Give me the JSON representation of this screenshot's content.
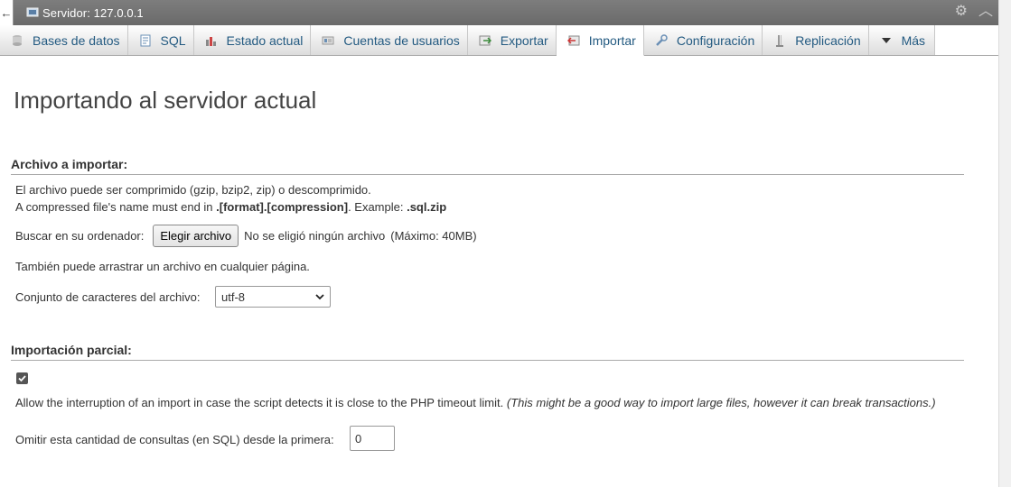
{
  "topbar": {
    "back_label": "←",
    "server_title": "Servidor: 127.0.0.1"
  },
  "tabs": [
    {
      "label": "Bases de datos",
      "icon": "database-icon"
    },
    {
      "label": "SQL",
      "icon": "sql-icon"
    },
    {
      "label": "Estado actual",
      "icon": "status-chart-icon"
    },
    {
      "label": "Cuentas de usuarios",
      "icon": "users-icon"
    },
    {
      "label": "Exportar",
      "icon": "export-icon"
    },
    {
      "label": "Importar",
      "icon": "import-icon",
      "active": true
    },
    {
      "label": "Configuración",
      "icon": "wrench-icon"
    },
    {
      "label": "Replicación",
      "icon": "replication-icon"
    },
    {
      "label": "Más",
      "icon": "caret-down-icon"
    }
  ],
  "page": {
    "title": "Importando al servidor actual"
  },
  "file_section": {
    "heading": "Archivo a importar:",
    "line1": "El archivo puede ser comprimido (gzip, bzip2, zip) o descomprimido.",
    "line2_prefix": "A compressed file's name must end in ",
    "line2_bold": ".[format].[compression]",
    "line2_mid": ". Example: ",
    "line2_example": ".sql.zip",
    "browse_label": "Buscar en su ordenador:",
    "browse_button": "Elegir archivo",
    "no_file": "No se eligió ningún archivo",
    "max_size": "(Máximo: 40MB)",
    "drag_hint": "También puede arrastrar un archivo en cualquier página.",
    "charset_label": "Conjunto de caracteres del archivo:",
    "charset_value": "utf-8"
  },
  "partial_section": {
    "heading": "Importación parcial:",
    "allow_interrupt_checked": true,
    "allow_interrupt_text": "Allow the interruption of an import in case the script detects it is close to the PHP timeout limit.",
    "allow_interrupt_note": "(This might be a good way to import large files, however it can break transactions.)",
    "skip_label": "Omitir esta cantidad de consultas (en SQL) desde la primera:",
    "skip_value": "0"
  }
}
